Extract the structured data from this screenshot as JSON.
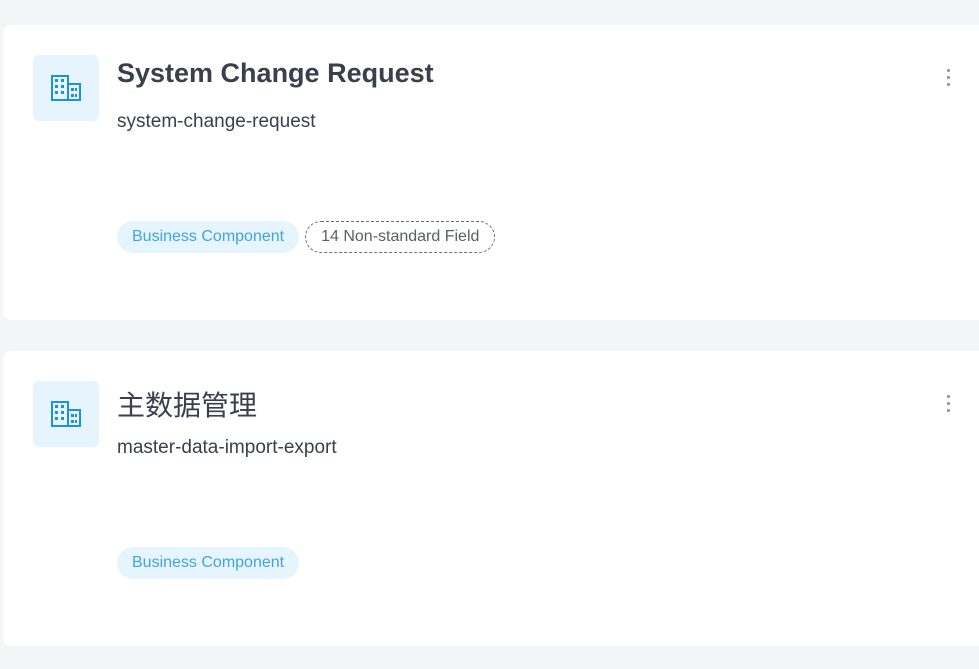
{
  "cards": [
    {
      "icon": "building-icon",
      "title": "System Change Request",
      "key": "system-change-request",
      "tags": {
        "type": "Business Component",
        "fields": "14 Non-standard Field"
      }
    },
    {
      "icon": "building-icon",
      "title": "主数据管理",
      "key": "master-data-import-export",
      "tags": {
        "type": "Business Component"
      }
    }
  ],
  "colors": {
    "background": "#f3f5f7",
    "card": "#ffffff",
    "icon_bg": "#e6f4fd",
    "icon_fg": "#1f8fe0",
    "tag_text": "#41a5dc",
    "title_text": "#3a3f4b"
  },
  "menu_icon": "more-vertical-icon"
}
